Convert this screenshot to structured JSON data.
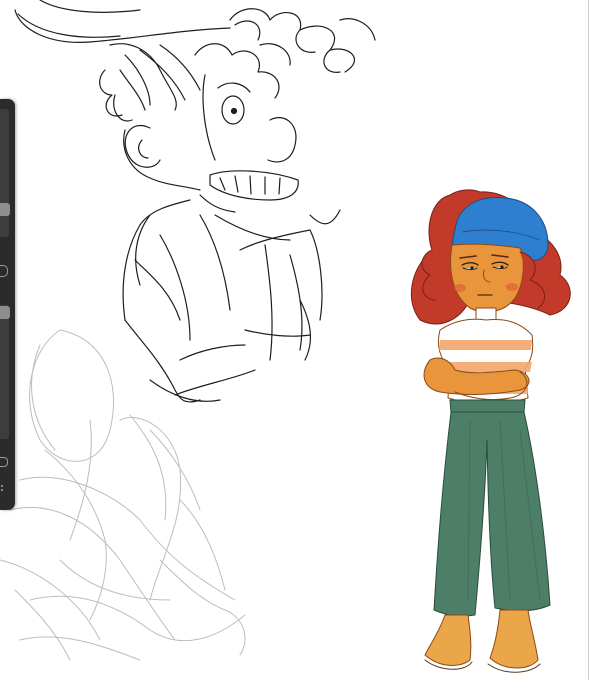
{
  "canvas": {
    "background": "#ffffff",
    "colors": {
      "pencil_dark": "#1e1e1e",
      "pencil_light": "#b8b8b8",
      "hair": "#c23b2a",
      "beanie": "#2f7fd0",
      "skin": "#e9953c",
      "shirt_stripe": "#f4a46a",
      "pants": "#4d7e68",
      "shoes": "#eba64a"
    }
  },
  "sidebar": {
    "brush_size_value": 0.26,
    "opacity_value": 0.0,
    "icons": [
      "square-icon",
      "undo-icon"
    ]
  }
}
